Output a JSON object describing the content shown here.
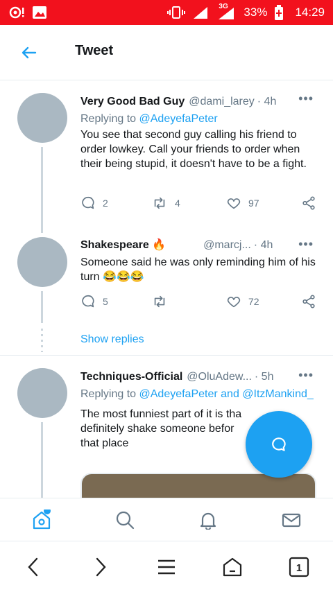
{
  "status_bar": {
    "battery": "33%",
    "time": "14:29",
    "network": "3G",
    "icons": [
      "notification-icon",
      "image-icon",
      "vibrate-icon",
      "signal-icon",
      "battery-charging-icon"
    ]
  },
  "header": {
    "title": "Tweet"
  },
  "tweets": [
    {
      "name": "Very Good Bad Guy",
      "handle": "@dami_larey",
      "time": "· 4h",
      "replying_prefix": "Replying to ",
      "replying_to": "@AdeyefaPeter",
      "text": "You see that second guy calling his friend to order lowkey. Call your friends to order when their being stupid, it doesn't have to be a fight.",
      "replies": "2",
      "retweets": "4",
      "likes": "97"
    },
    {
      "name": "Shakespeare 🔥",
      "handle": "@marcj...",
      "time": "· 4h",
      "text": "Someone said he was only reminding him of his turn 😂😂😂",
      "replies": "5",
      "retweets": "",
      "likes": "72",
      "show_replies": "Show replies"
    },
    {
      "name": "Techniques-Official",
      "handle": "@OluAdew...",
      "time": "· 5h",
      "replying_prefix": "Replying to ",
      "replying_to": "@AdeyefaPeter",
      "replying_and": " and ",
      "replying_to_2": "@ItzMankind_",
      "text_lines": [
        "The most funniest part of it is tha",
        "definitely shake someone befor",
        "that place"
      ]
    }
  ],
  "colors": {
    "accent": "#1da1f2",
    "status_bar": "#f2111d",
    "avatar": "#aab8c2"
  }
}
